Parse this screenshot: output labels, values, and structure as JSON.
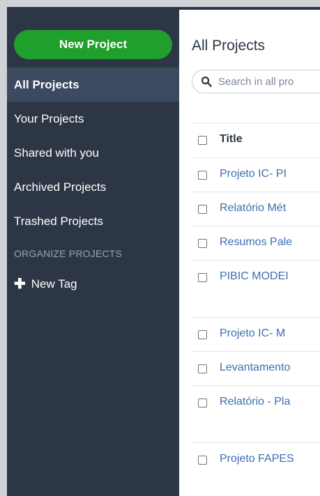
{
  "sidebar": {
    "new_project_label": "New Project",
    "items": [
      {
        "label": "All Projects",
        "active": true
      },
      {
        "label": "Your Projects"
      },
      {
        "label": "Shared with you"
      },
      {
        "label": "Archived Projects"
      },
      {
        "label": "Trashed Projects"
      }
    ],
    "section_label": "ORGANIZE PROJECTS",
    "new_tag_label": "New Tag",
    "new_tag_icon": "plus-icon"
  },
  "main": {
    "title": "All Projects",
    "search": {
      "placeholder": "Search in all pro",
      "icon": "search-icon"
    },
    "table": {
      "title_header": "Title",
      "rows": [
        {
          "title": "Projeto IC- PI"
        },
        {
          "title": "Relatório Mét"
        },
        {
          "title": "Resumos Pale"
        },
        {
          "title": "PIBIC MODEI"
        },
        {
          "title": "Projeto IC- M"
        },
        {
          "title": "Levantamento"
        },
        {
          "title": "Relatório - Pla"
        },
        {
          "title": "Projeto FAPES"
        }
      ]
    }
  },
  "colors": {
    "sidebar_bg": "#2c3645",
    "sidebar_active": "#3b4a5e",
    "new_project_green": "#1f9f2b",
    "link_blue": "#3a6fb2",
    "heading_text": "#2c3645"
  }
}
